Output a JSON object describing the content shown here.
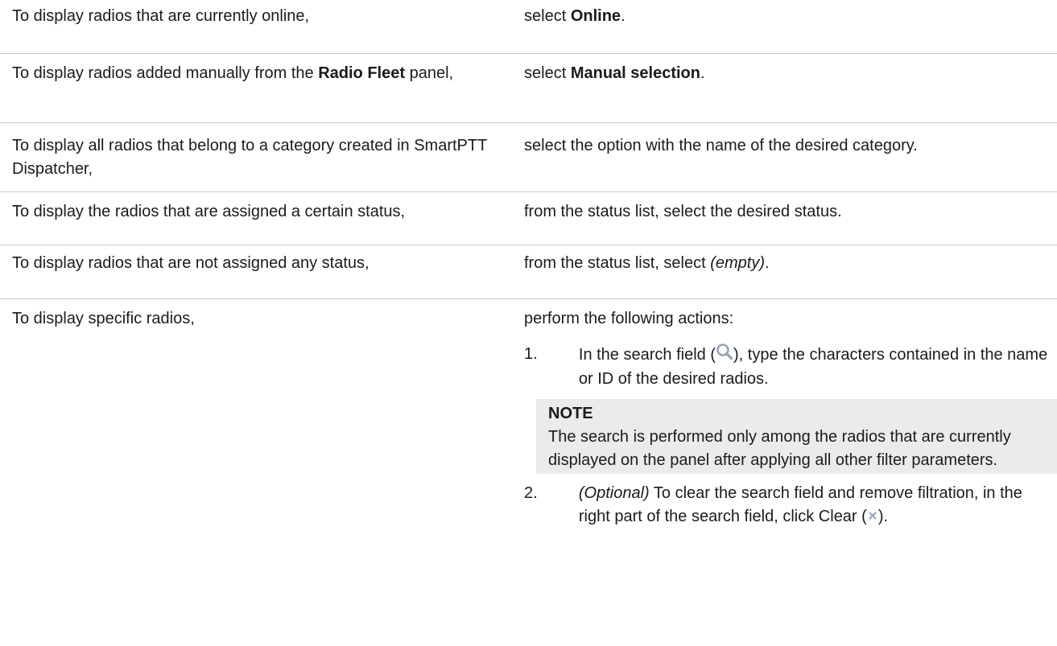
{
  "rows": [
    {
      "cond_pre": "To display radios that are currently online,",
      "cond_bold": "",
      "cond_post": "",
      "act_pre": "select ",
      "act_bold": "Online",
      "act_post": "."
    },
    {
      "cond_pre": "To display radios added manually from the ",
      "cond_bold": "Radio Fleet",
      "cond_post": " panel,",
      "act_pre": "select ",
      "act_bold": "Manual selection",
      "act_post": "."
    },
    {
      "cond_pre": "To display all radios that belong to a category created in SmartPTT Dispatcher,",
      "cond_bold": "",
      "cond_post": "",
      "act_pre": "select the option with the name of the desired category.",
      "act_bold": "",
      "act_post": ""
    },
    {
      "cond_pre": "To display the radios that are assigned a certain status,",
      "cond_bold": "",
      "cond_post": "",
      "act_pre": "from the status list, select the desired status.",
      "act_bold": "",
      "act_post": ""
    },
    {
      "cond_pre": "To display radios that are not assigned any status,",
      "cond_bold": "",
      "cond_post": "",
      "act_pre": "from the status list, select ",
      "act_italic": "(empty)",
      "act_post": "."
    },
    {
      "cond_pre": "To display specific radios,",
      "act_pre": "perform the following actions:"
    }
  ],
  "steps": {
    "s1_num": "1.",
    "s1_pre": "In the search field (",
    "s1_icon": "search-icon",
    "s1_post": "), type the characters contained in the name or ID of the desired radios.",
    "note_title": "NOTE",
    "note_text": "The search is performed only among the radios that are currently displayed on the panel after applying all other filter parameters.",
    "s2_num": "2.",
    "s2_italic": "(Optional)",
    "s2_text": " To clear the search field and remove filtration, in the right part of the search field, click Clear (",
    "s2_icon": "clear-icon",
    "s2_post": ")."
  },
  "colors": {
    "border": "#c8c8c8",
    "note_bg": "#ebebeb",
    "icon": "#9aa4b5"
  }
}
